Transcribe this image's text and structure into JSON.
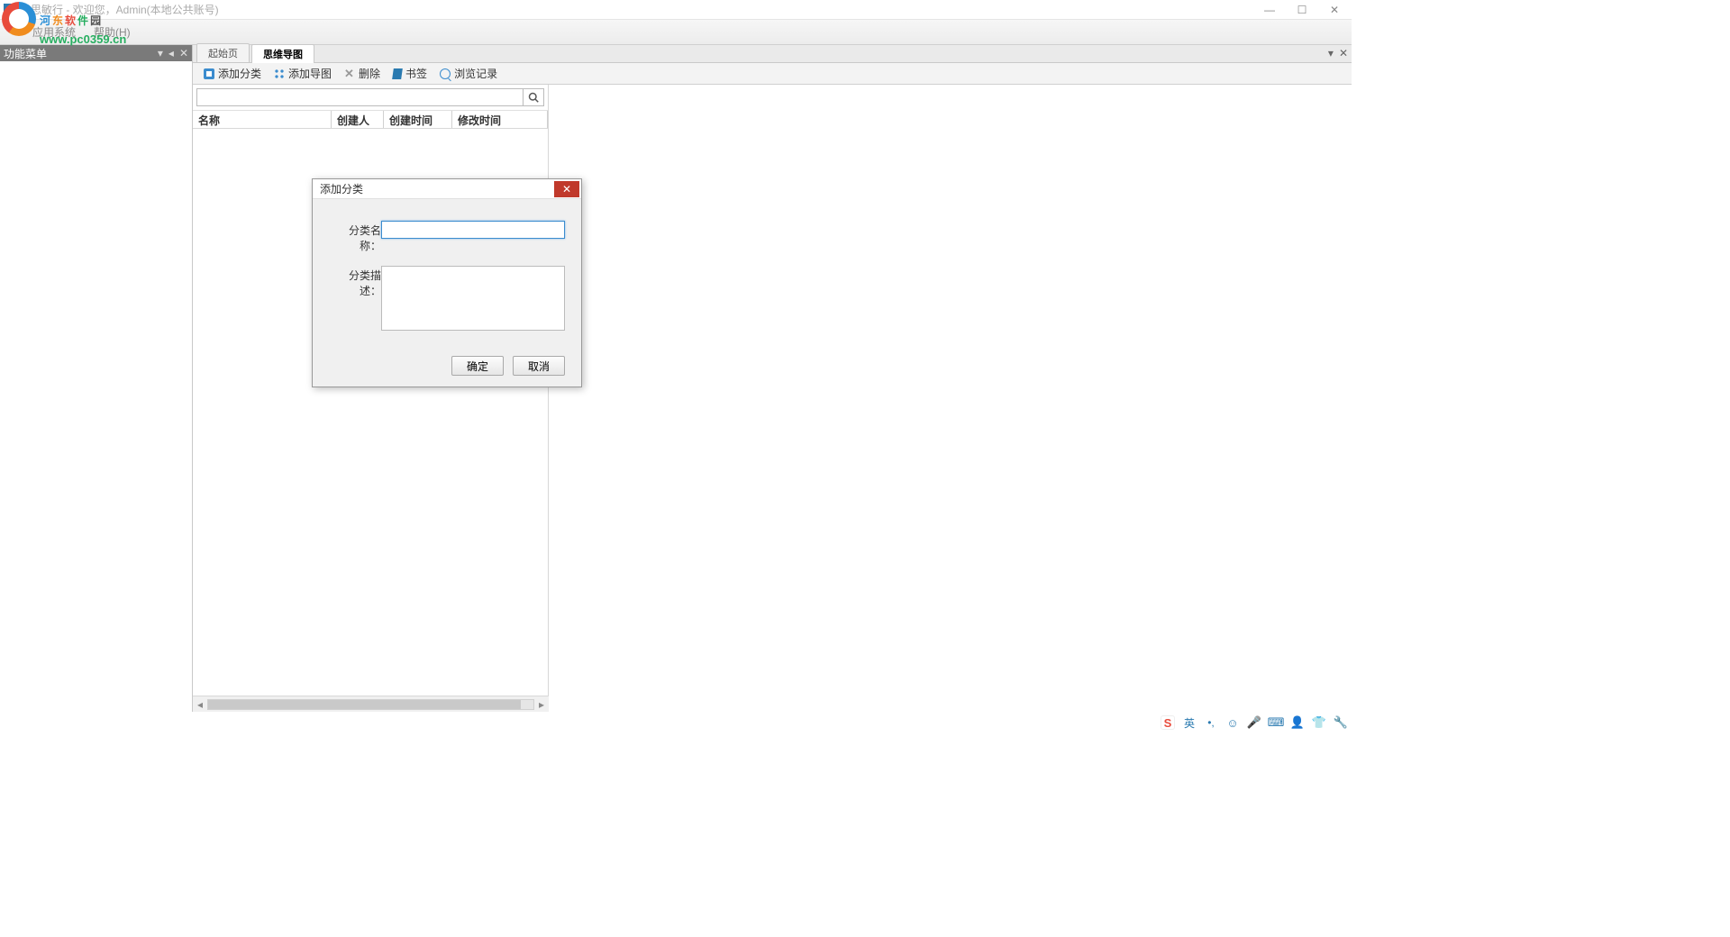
{
  "window": {
    "title": "志思敏行 - 欢迎您，Admin(本地公共账号)",
    "min": "—",
    "max": "☐",
    "close": "✕"
  },
  "watermark": {
    "cn1": "河",
    "cn2": "东",
    "cn3": "软",
    "cn4": "件",
    "cn5": "园",
    "url": "www.pc0359.cn"
  },
  "menu": {
    "m1": "应用系统",
    "m2": "帮助(H)"
  },
  "sidebar": {
    "title": "功能菜单",
    "pin": "▾",
    "close": "✕"
  },
  "tabs": {
    "t1": "起始页",
    "t2": "思维导图",
    "menu": "▾",
    "x": "✕"
  },
  "toolbar": {
    "addCat": "添加分类",
    "addMap": "添加导图",
    "del": "删除",
    "bookmark": "书签",
    "browse": "浏览记录"
  },
  "search": {
    "placeholder": ""
  },
  "columns": {
    "c1": "名称",
    "c2": "创建人",
    "c3": "创建时间",
    "c4": "修改时间"
  },
  "dialog": {
    "title": "添加分类",
    "labelName": "分类名称：",
    "labelDesc": "分类描述：",
    "ok": "确定",
    "cancel": "取消"
  },
  "tray": {
    "sogou": "S",
    "lang": "英",
    "punct": "•,"
  }
}
